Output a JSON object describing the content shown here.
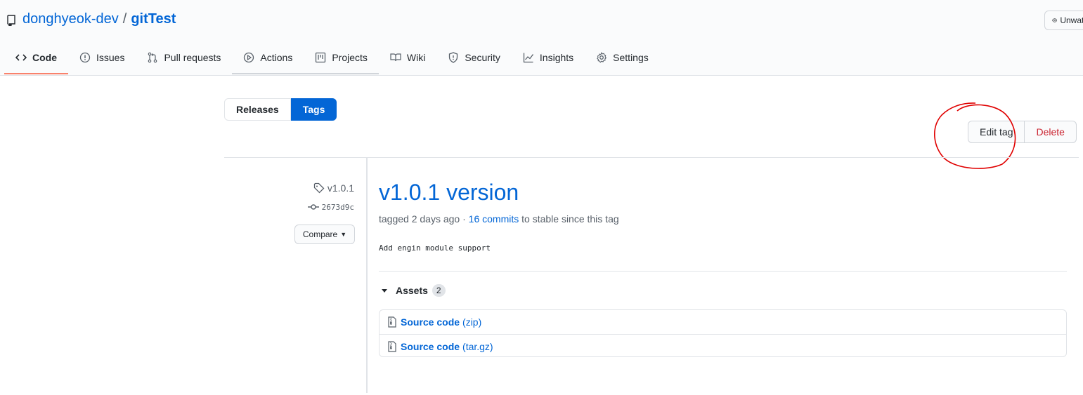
{
  "repo": {
    "owner": "donghyeok-dev",
    "separator": "/",
    "name": "gitTest"
  },
  "watch": {
    "label": "Unwatch"
  },
  "tabs": [
    {
      "label": "Code",
      "icon": "code-icon"
    },
    {
      "label": "Issues",
      "icon": "issue-icon"
    },
    {
      "label": "Pull requests",
      "icon": "pull-request-icon"
    },
    {
      "label": "Actions",
      "icon": "play-icon"
    },
    {
      "label": "Projects",
      "icon": "project-icon"
    },
    {
      "label": "Wiki",
      "icon": "book-icon"
    },
    {
      "label": "Security",
      "icon": "shield-icon"
    },
    {
      "label": "Insights",
      "icon": "graph-icon"
    },
    {
      "label": "Settings",
      "icon": "gear-icon"
    }
  ],
  "subnav": {
    "releases": "Releases",
    "tags": "Tags"
  },
  "actions": {
    "edit": "Edit tag",
    "delete": "Delete"
  },
  "meta": {
    "tag": "v1.0.1",
    "commit": "2673d9c",
    "compare": "Compare"
  },
  "release": {
    "title": "v1.0.1 version",
    "tagged": "tagged 2 days ago · ",
    "commits": "16 commits",
    "since": " to stable since this tag",
    "body": "Add engin module support"
  },
  "assets": {
    "label": "Assets",
    "count": "2",
    "items": [
      {
        "name": "Source code",
        "ext": "(zip)"
      },
      {
        "name": "Source code",
        "ext": "(tar.gz)"
      }
    ]
  },
  "colors": {
    "link": "#0366d6",
    "danger": "#cb2431",
    "annotation": "#e00000",
    "active_tab": "#f9826c"
  }
}
